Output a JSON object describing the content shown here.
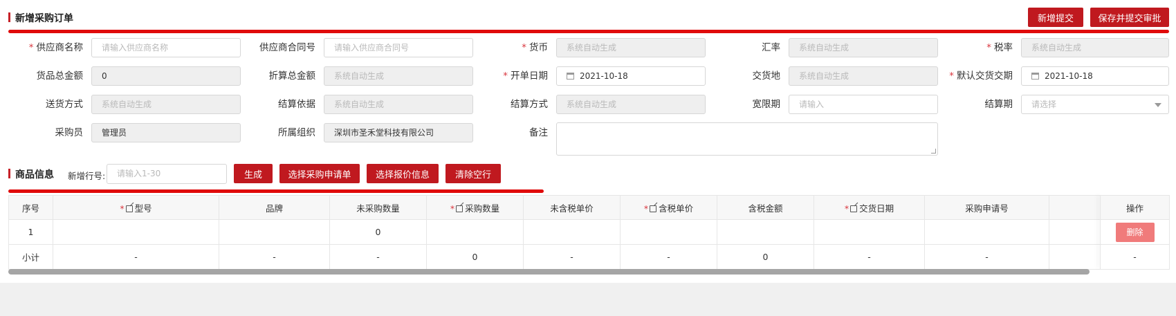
{
  "header": {
    "title": "新增采购订单",
    "btn_new_submit": "新增提交",
    "btn_save_submit": "保存并提交审批"
  },
  "form": {
    "supplier_name": {
      "label": "供应商名称",
      "placeholder": "请输入供应商名称",
      "required": true
    },
    "supplier_contract": {
      "label": "供应商合同号",
      "placeholder": "请输入供应商合同号"
    },
    "currency": {
      "label": "货币",
      "placeholder": "系统自动生成",
      "required": true
    },
    "exchange_rate": {
      "label": "汇率",
      "placeholder": "系统自动生成"
    },
    "tax_rate": {
      "label": "税率",
      "placeholder": "系统自动生成",
      "required": true
    },
    "goods_total": {
      "label": "货品总金额",
      "value": "0"
    },
    "converted_total": {
      "label": "折算总金额",
      "placeholder": "系统自动生成"
    },
    "order_date": {
      "label": "开单日期",
      "value": "2021-10-18",
      "required": true
    },
    "delivery_place": {
      "label": "交货地",
      "placeholder": "系统自动生成"
    },
    "default_delivery": {
      "label": "默认交货交期",
      "value": "2021-10-18",
      "required": true
    },
    "shipping_method": {
      "label": "送货方式",
      "placeholder": "系统自动生成"
    },
    "settlement_basis": {
      "label": "结算依据",
      "placeholder": "系统自动生成"
    },
    "settlement_method": {
      "label": "结算方式",
      "placeholder": "系统自动生成"
    },
    "grace_period": {
      "label": "宽限期",
      "placeholder": "请输入"
    },
    "settlement_period": {
      "label": "结算期",
      "placeholder": "请选择"
    },
    "purchaser": {
      "label": "采购员",
      "value": "管理员"
    },
    "organization": {
      "label": "所属组织",
      "value": "深圳市圣禾堂科技有限公司"
    },
    "remark": {
      "label": "备注"
    }
  },
  "goods": {
    "title": "商品信息",
    "add_row_label": "新增行号:",
    "add_row_placeholder": "请输入1-30",
    "btn_generate": "生成",
    "btn_select_request": "选择采购申请单",
    "btn_select_quote": "选择报价信息",
    "btn_clear_empty": "清除空行"
  },
  "table": {
    "columns": [
      {
        "label": "序号",
        "required": false,
        "editable": false
      },
      {
        "label": "型号",
        "required": true,
        "editable": true
      },
      {
        "label": "品牌",
        "required": false,
        "editable": false
      },
      {
        "label": "未采购数量",
        "required": false,
        "editable": false
      },
      {
        "label": "采购数量",
        "required": true,
        "editable": true
      },
      {
        "label": "未含税单价",
        "required": false,
        "editable": false
      },
      {
        "label": "含税单价",
        "required": true,
        "editable": true
      },
      {
        "label": "含税金额",
        "required": false,
        "editable": false
      },
      {
        "label": "交货日期",
        "required": true,
        "editable": true
      },
      {
        "label": "采购申请号",
        "required": false,
        "editable": false
      },
      {
        "label": "",
        "required": false,
        "editable": false
      },
      {
        "label": "操作",
        "required": false,
        "editable": false
      }
    ],
    "rows": [
      [
        "1",
        "",
        "",
        "0",
        "",
        "",
        "",
        "",
        "",
        "",
        "",
        ""
      ]
    ],
    "delete_label": "删除",
    "subtotal": [
      "小计",
      "-",
      "-",
      "-",
      "0",
      "-",
      "-",
      "0",
      "-",
      "-",
      "",
      "-"
    ]
  },
  "colors": {
    "primary": "#c0191f",
    "accent_line": "#e00b0b",
    "delete_button": "#f07b7b"
  }
}
